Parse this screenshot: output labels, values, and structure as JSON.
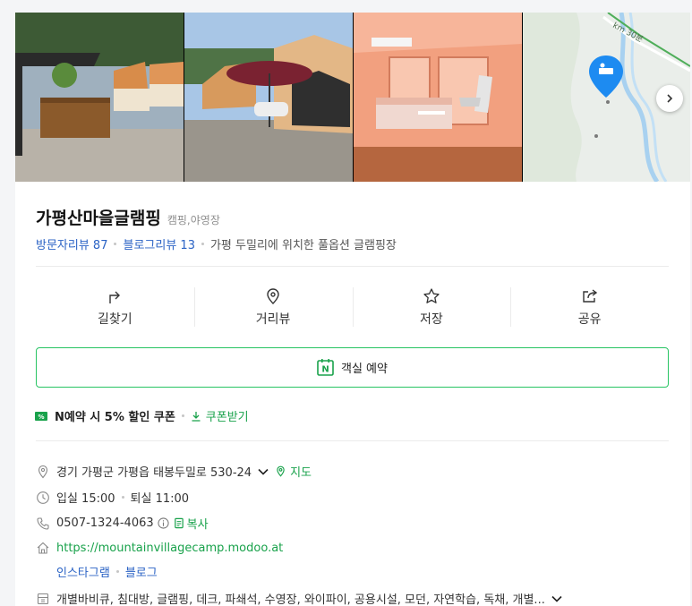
{
  "place": {
    "name": "가평산마을글램핑",
    "category": "캠핑,야영장",
    "visitor_reviews": "방문자리뷰 87",
    "blog_reviews": "블로그리뷰 13",
    "description": "가평 두밀리에 위치한 풀옵션 글램핑장"
  },
  "gallery": {
    "photos": [
      "camp-terrace-photo",
      "tent-parasol-photo",
      "tent-interior-photo"
    ],
    "map_label": "km 30분"
  },
  "actions": {
    "directions": "길찾기",
    "street_view": "거리뷰",
    "save": "저장",
    "share": "공유"
  },
  "booking": {
    "label": "객실 예약",
    "brand_icon": "N"
  },
  "coupon": {
    "badge": "%",
    "text": "N예약 시 5% 할인 쿠폰",
    "get_label": "쿠폰받기"
  },
  "info": {
    "address": "경기 가평군 가평읍 태봉두밀로 530-24",
    "map_label": "지도",
    "checkin": "입실 15:00",
    "checkout": "퇴실 11:00",
    "phone": "0507-1324-4063",
    "copy_label": "복사",
    "website": "https://mountainvillagecamp.modoo.at",
    "instagram": "인스타그램",
    "blog": "블로그",
    "amenities": "개별바비큐, 침대방, 글램핑, 데크, 파쇄석, 수영장, 와이파이, 공용시설, 모던, 자연학습, 독채, 개별..."
  },
  "colors": {
    "accent_green": "#19a24b",
    "booking_border": "#27c463",
    "link_blue": "#2b63c5",
    "map_pin": "#1d8bf1"
  }
}
